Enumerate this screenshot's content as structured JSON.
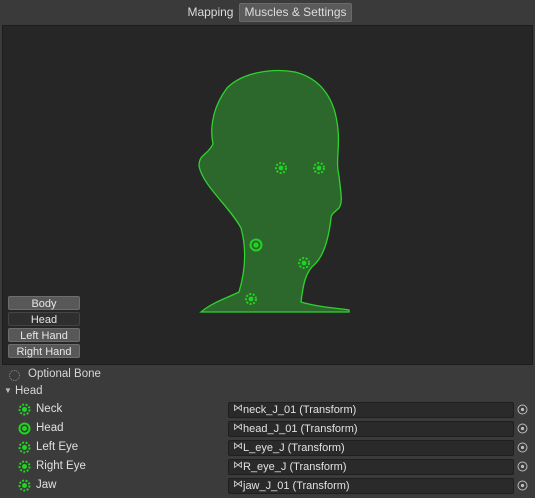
{
  "tabs": [
    {
      "label": "Mapping",
      "active": false
    },
    {
      "label": "Muscles & Settings",
      "active": true
    }
  ],
  "viewport": {
    "silhouette": "head",
    "silhouette_color": "#2bd62b",
    "fill_color": "#2f6a2f"
  },
  "body_parts": [
    {
      "label": "Body",
      "active": false
    },
    {
      "label": "Head",
      "active": true
    },
    {
      "label": "Left Hand",
      "active": false
    },
    {
      "label": "Right Hand",
      "active": false
    }
  ],
  "legend": {
    "optional_bone_label": "Optional Bone"
  },
  "group": {
    "label": "Head"
  },
  "bones": [
    {
      "name": "Neck",
      "transform": "neck_J_01 (Transform)",
      "icon": "optional-bone-icon"
    },
    {
      "name": "Head",
      "transform": "head_J_01 (Transform)",
      "icon": "required-bone-icon"
    },
    {
      "name": "Left Eye",
      "transform": "L_eye_J (Transform)",
      "icon": "optional-bone-icon"
    },
    {
      "name": "Right Eye",
      "transform": "R_eye_J (Transform)",
      "icon": "optional-bone-icon"
    },
    {
      "name": "Jaw",
      "transform": "jaw_J_01 (Transform)",
      "icon": "optional-bone-icon"
    }
  ],
  "colors": {
    "accent": "#1fd11f",
    "background": "#3b3b3b",
    "viewport": "#262626"
  }
}
